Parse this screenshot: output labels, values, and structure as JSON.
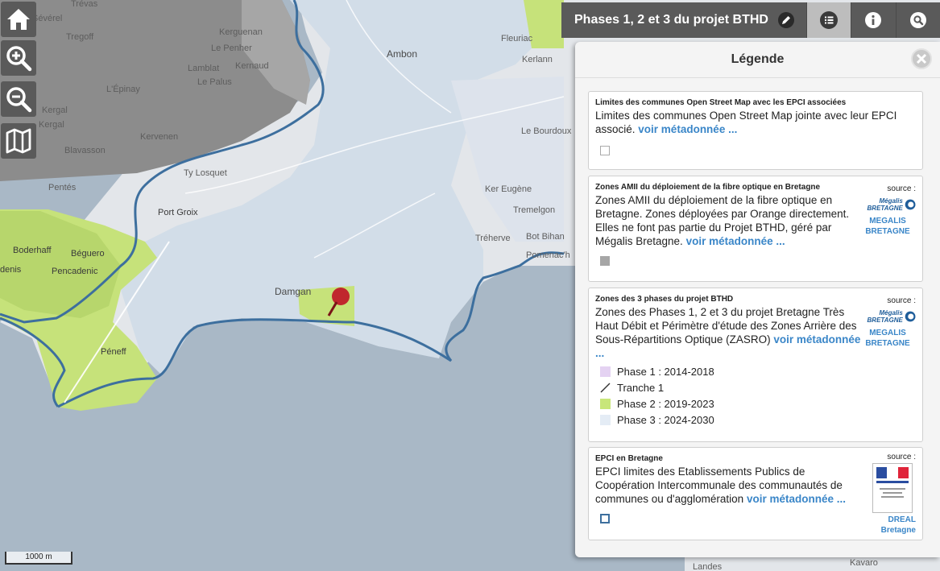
{
  "map": {
    "places": [
      "Sévérel",
      "Trévas",
      "Kerguenan",
      "Tregoff",
      "Le Penher",
      "Kernaud",
      "Lamblat",
      "Le Palus",
      "L'Épinay",
      "Kergal",
      "Kergal",
      "Kervenen",
      "Blavasson",
      "Ty Losquet",
      "Pentés",
      "Port Groix",
      "Boderhaff",
      "Béguero",
      "Pencadenic",
      "Péneff",
      "Damgan",
      "Ambon",
      "Fleuriac",
      "Kerlann",
      "Le Bourdoux",
      "Ker Eugène",
      "Tremelgon",
      "Tréherve",
      "Bot Bihan",
      "Pomenac'h",
      "Landes",
      "Kavaro",
      "denis"
    ],
    "scale_label": "1000 m",
    "colors": {
      "sea": "#a9b8c6",
      "land": "#e3e6ea",
      "phase2": "#c6e27a",
      "phase3": "#d2dde8",
      "epci": "#3d6f9e"
    }
  },
  "controls": {
    "home_icon": "home-icon",
    "zoom_in_icon": "zoom-in-icon",
    "zoom_out_icon": "zoom-out-icon",
    "map_icon": "map-icon"
  },
  "toolbar": {
    "title": "Phases 1, 2 et 3 du projet BTHD",
    "icons": [
      "pencil-icon",
      "list-icon",
      "info-icon",
      "search-icon"
    ]
  },
  "legend": {
    "title": "Légende",
    "link_label": "voir métadonnée ...",
    "source_label": "source :",
    "layers": [
      {
        "title": "Limites des communes Open Street Map avec les EPCI associées",
        "description": "Limites des communes Open Street Map jointe avec leur EPCI associé."
      },
      {
        "title": "Zones AMII du déploiement de la fibre optique en Bretagne",
        "description": "Zones AMII du déploiement de la fibre optique en Bretagne. Zones déployées par Orange directement. Elles ne font pas partie du Projet BTHD, géré par Mégalis Bretagne.",
        "source_name": "MEGALIS BRETAGNE",
        "logo_text": "Mégalis BRETAGNE"
      },
      {
        "title": "Zones des 3 phases du projet BTHD",
        "description": "Zones des Phases 1, 2 et 3 du projet Bretagne Très Haut Débit et Périmètre d'étude des Zones Arrière des Sous-Répartitions Optique (ZASRO)",
        "source_name": "MEGALIS BRETAGNE",
        "logo_text": "Mégalis BRETAGNE",
        "items": [
          {
            "label": "Phase 1 : 2014-2018",
            "color": "#e4d2f2",
            "kind": "fill"
          },
          {
            "label": "Tranche 1",
            "color": "#333333",
            "kind": "line"
          },
          {
            "label": "Phase 2 : 2019-2023",
            "color": "#c8e67a",
            "kind": "fill"
          },
          {
            "label": "Phase 3 : 2024-2030",
            "color": "#e4ecf5",
            "kind": "fill"
          }
        ]
      },
      {
        "title": "EPCI en Bretagne",
        "description": "EPCI limites des Etablissements Publics de Coopération Intercommunale des communautés de communes ou d'agglomération",
        "source_name": "DREAL Bretagne"
      }
    ]
  }
}
